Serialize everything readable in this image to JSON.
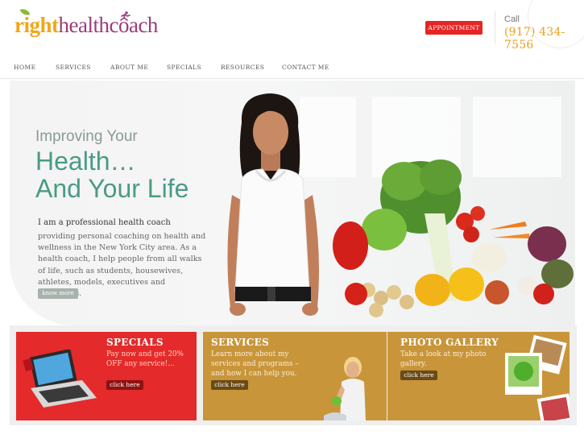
{
  "header": {
    "logo_right": "right",
    "logo_health": "health",
    "logo_coach": "coach",
    "appointment_label": "APPOINTMENT",
    "call_label": "Call",
    "phone": "(917) 434-7556"
  },
  "nav": {
    "items": [
      "HOME",
      "SERVICES",
      "ABOUT ME",
      "SPECIALS",
      "RESOURCES",
      "CONTACT ME"
    ]
  },
  "hero": {
    "headline_small": "Improving Your",
    "headline_line1": "Health…",
    "headline_line2": "And Your Life",
    "intro_title": "I am a professional health coach",
    "intro_body": "providing personal coaching on health and wellness in the New York City area. As a health coach, I help people from all walks of life, such as students, housewives, athletes, models, executives and celebrities.",
    "know_more": "know more"
  },
  "panels": {
    "specials": {
      "title": "SPECIALS",
      "desc": "Pay now and get 20% OFF any service!...",
      "button": "click here"
    },
    "services": {
      "title": "SERVICES",
      "desc": "Learn more about my services and programs – and how I can help you.",
      "button": "click here"
    },
    "gallery": {
      "title": "PHOTO GALLERY",
      "desc": "Take a look at my photo gallery.",
      "button": "click here"
    }
  },
  "colors": {
    "accent_red": "#e42a2a",
    "accent_gold": "#c8953a",
    "headline_green": "#4a9b86",
    "logo_orange": "#f2a61a",
    "logo_purple": "#9b3d7a",
    "phone_orange": "#e8a020"
  },
  "icons": [
    "leaf-icon",
    "runner-icon",
    "laptop-icon",
    "woman-photo",
    "polaroid-icon"
  ]
}
